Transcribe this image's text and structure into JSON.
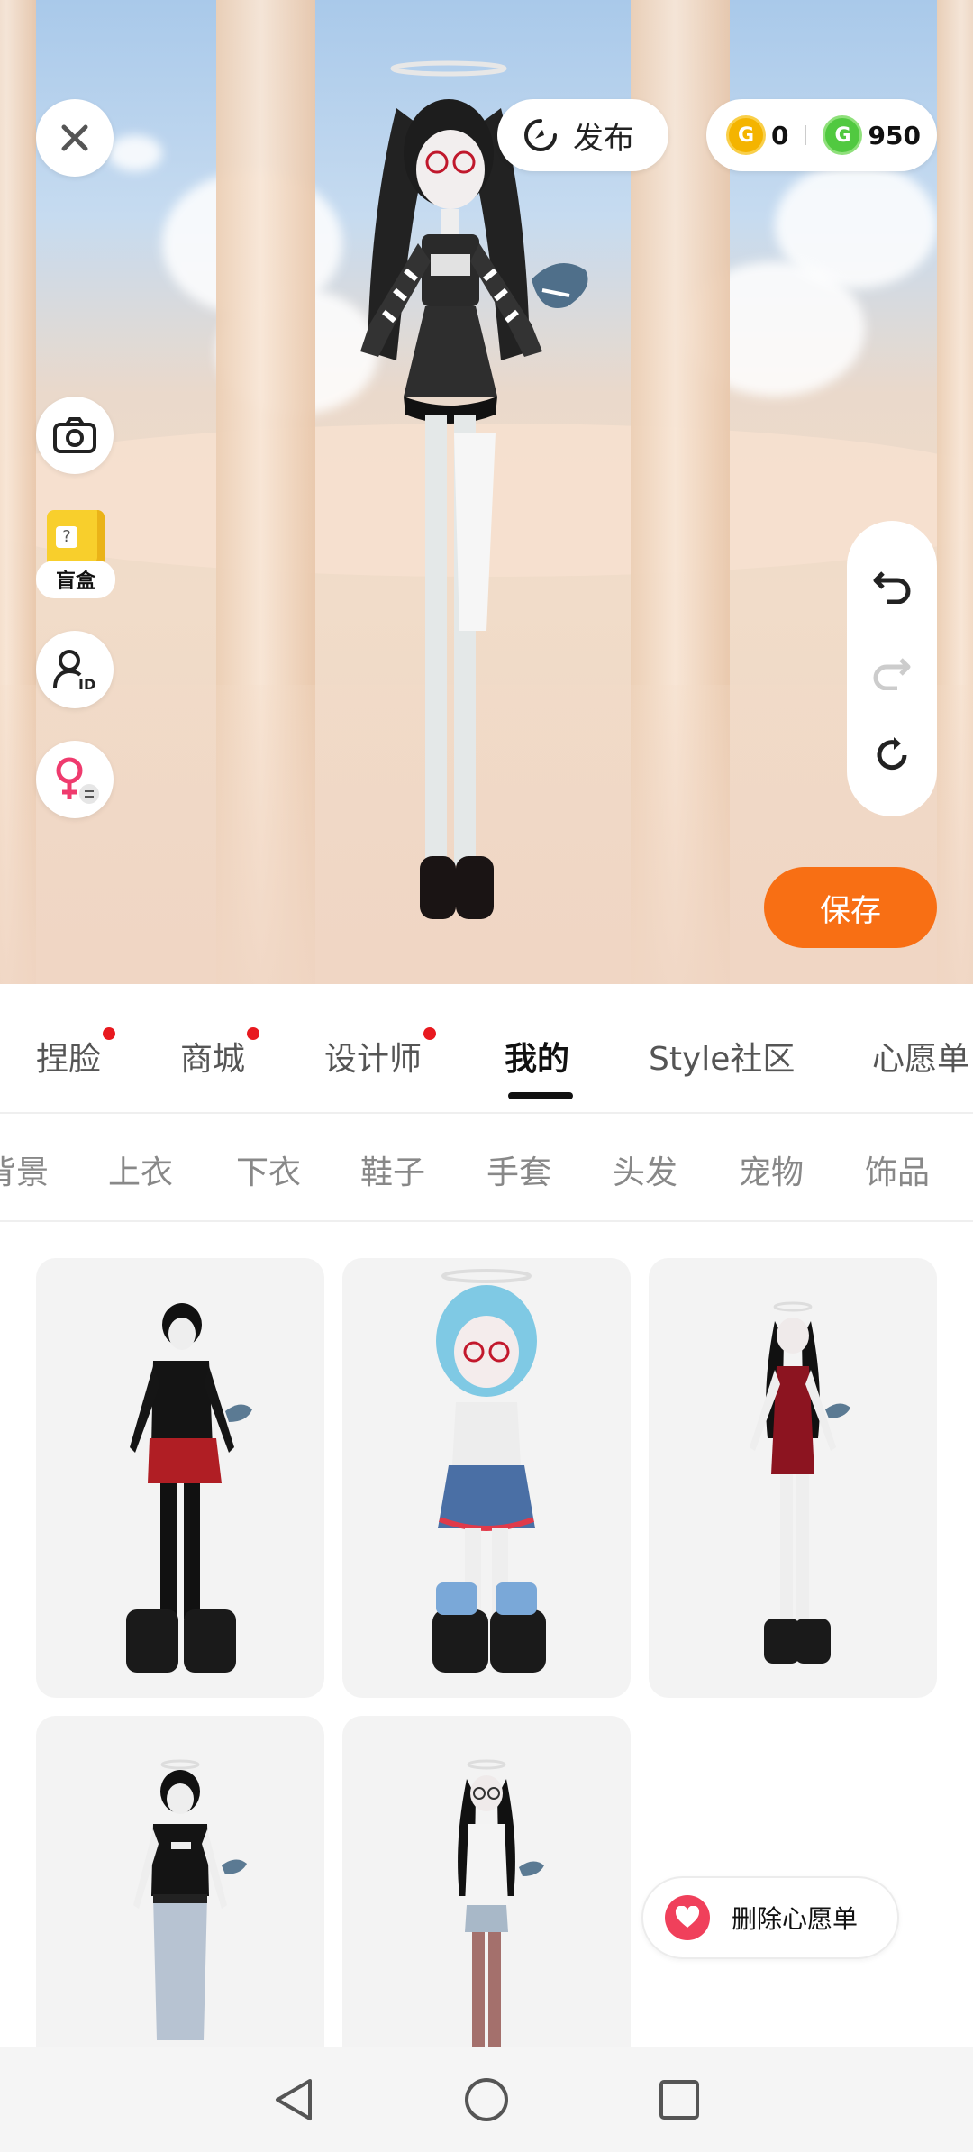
{
  "top": {
    "publish_label": "发布",
    "coins": {
      "gold": "0",
      "green": "950"
    },
    "blindbox_label": "盲盒"
  },
  "save_label": "保存",
  "tabs": [
    {
      "label": "捏脸",
      "dot": true
    },
    {
      "label": "商城",
      "dot": true
    },
    {
      "label": "设计师",
      "dot": true
    },
    {
      "label": "我的",
      "active": true
    },
    {
      "label": "Style社区"
    },
    {
      "label": "心愿单"
    }
  ],
  "categories": [
    "背景",
    "上衣",
    "下衣",
    "鞋子",
    "手套",
    "头发",
    "宠物",
    "饰品"
  ],
  "wishlist_button": "删除心愿单",
  "colors": {
    "accent": "#f86f14",
    "badge": "#e8191f",
    "heart": "#f0405b"
  },
  "icons": [
    "close-icon",
    "publish-icon",
    "camera-icon",
    "id-icon",
    "gender-switch-icon",
    "undo-icon",
    "redo-icon",
    "reset-icon",
    "back-icon",
    "home-icon",
    "recents-icon"
  ]
}
